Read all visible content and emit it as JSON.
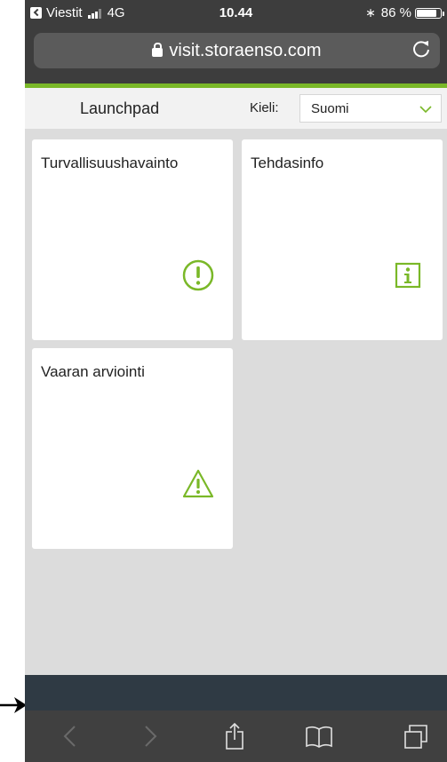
{
  "status_bar": {
    "back_app_label": "Viestit",
    "network": "4G",
    "time": "10.44",
    "battery_percent": "86 %",
    "battery_level": 0.86
  },
  "browser": {
    "url": "visit.storaenso.com"
  },
  "app": {
    "title": "Launchpad",
    "language_label": "Kieli:",
    "language_value": "Suomi"
  },
  "tiles": [
    {
      "title": "Turvallisuushavainto",
      "icon": "exclamation-circle-icon"
    },
    {
      "title": "Tehdasinfo",
      "icon": "info-box-icon"
    },
    {
      "title": "Vaaran arviointi",
      "icon": "warning-triangle-icon"
    }
  ],
  "colors": {
    "accent_green": "#7ab828",
    "status_bar": "#3d3d3d",
    "toolbar": "#404040",
    "content_bg": "#dcdcdc"
  }
}
